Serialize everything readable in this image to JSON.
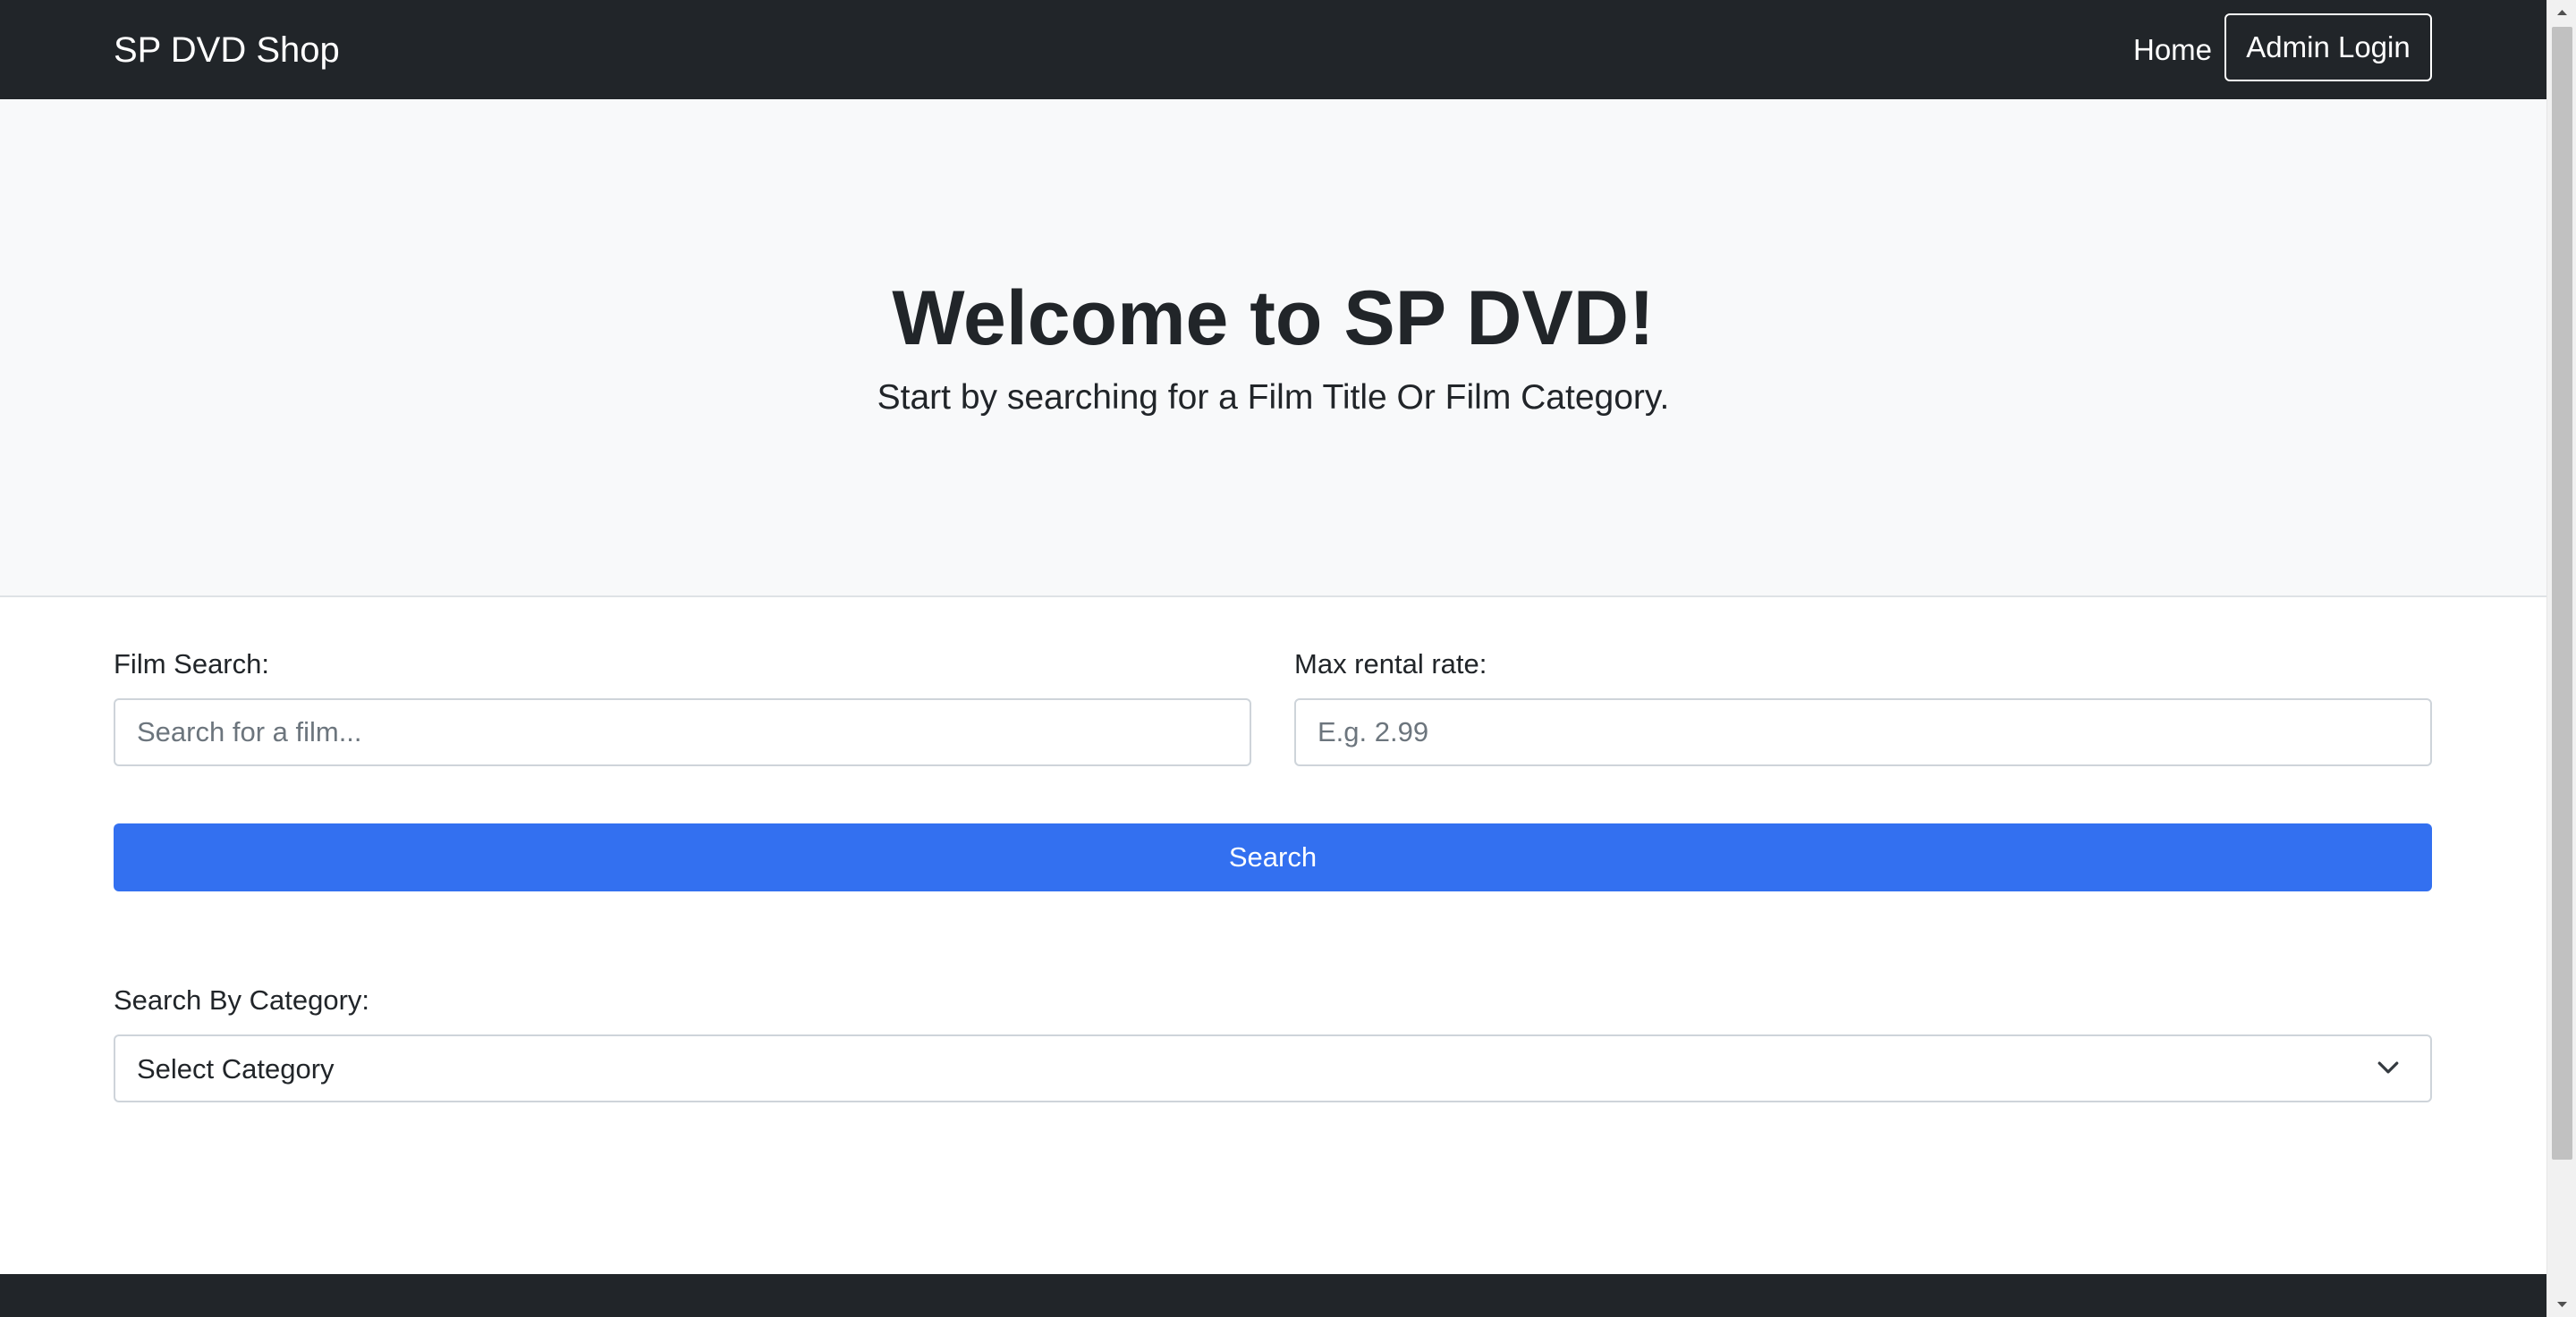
{
  "navbar": {
    "brand": "SP DVD Shop",
    "home_label": "Home",
    "admin_login_label": "Admin Login"
  },
  "hero": {
    "title": "Welcome to SP DVD!",
    "subtitle": "Start by searching for a Film Title Or Film Category."
  },
  "form": {
    "film_search": {
      "label": "Film Search:",
      "value": "",
      "placeholder": "Search for a film..."
    },
    "max_rental_rate": {
      "label": "Max rental rate:",
      "value": "",
      "placeholder": "E.g. 2.99"
    },
    "search_button_label": "Search",
    "category": {
      "label": "Search By Category:",
      "selected": "Select Category",
      "icon": "chevron-down-icon"
    }
  },
  "colors": {
    "navbar_bg": "#212529",
    "hero_bg": "#f8f9fa",
    "primary_button": "#3370f0",
    "footer_bg": "#212529"
  }
}
